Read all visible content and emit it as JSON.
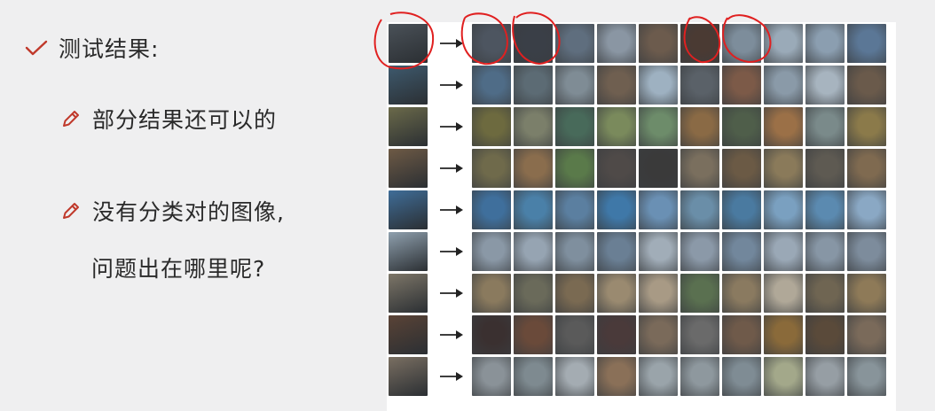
{
  "slide": {
    "heading": "测试结果:",
    "point1": "部分结果还可以的",
    "point2_line1": "没有分类对的图像,",
    "point2_line2": "问题出在哪里呢?"
  },
  "icons": {
    "heading_icon": "check-icon",
    "point_icon": "pencil-icon",
    "accent": "#c0392b"
  },
  "grid": {
    "rows": 9,
    "results_per_row": 10,
    "query_colors": [
      "#4a5158",
      "#3e5a6e",
      "#6b6a4a",
      "#6e5a45",
      "#3f6d98",
      "#8fa0ae",
      "#7d7668",
      "#5a4336",
      "#7a6f62"
    ],
    "row_palettes": [
      [
        "#4d5560",
        "#3a3f47",
        "#5f6e7e",
        "#8a96a3",
        "#6c5b4d",
        "#4a3a33",
        "#7d8d9b",
        "#9aaab8",
        "#8b9eb0",
        "#5b7796"
      ],
      [
        "#4f6c87",
        "#5c6b74",
        "#7f8c95",
        "#6f5f50",
        "#9eb1c1",
        "#5a6168",
        "#7c5a48",
        "#8a9aa8",
        "#a7b4bf",
        "#6a5a4b"
      ],
      [
        "#6d6a3f",
        "#7b7f6a",
        "#486a5a",
        "#7a8a5c",
        "#6d8c6a",
        "#8a6a45",
        "#4f5e4a",
        "#9b7047",
        "#7a8a8a",
        "#8b7a4a"
      ],
      [
        "#6f6a4b",
        "#8a6d4d",
        "#5a7a4a",
        "#4f4a48",
        "#3a3a3a",
        "#7a6f5e",
        "#6b5a45",
        "#8a7a5a",
        "#5e5a52",
        "#7f6a50"
      ],
      [
        "#3f6f9c",
        "#4a80a8",
        "#5b7fa0",
        "#3f78a8",
        "#6a90b4",
        "#6a8ea8",
        "#4a7aa0",
        "#7aa0c0",
        "#5b8ab0",
        "#8aa8c4"
      ],
      [
        "#8a98a6",
        "#96a4b2",
        "#7f8f9e",
        "#6a7f94",
        "#a1adb8",
        "#8b99a8",
        "#72879c",
        "#9aa8b6",
        "#8796a5",
        "#7d8c9c"
      ],
      [
        "#8a7a5e",
        "#6a6a5a",
        "#7a6a52",
        "#9a8a70",
        "#a89a85",
        "#5a7050",
        "#8a7a60",
        "#b0a898",
        "#6f6552",
        "#8e7a58"
      ],
      [
        "#3a3030",
        "#6a4a3a",
        "#5a5a5a",
        "#4a3a3a",
        "#7a6a5a",
        "#6a6a6a",
        "#6f5a4a",
        "#8a6a3a",
        "#5a4a3a",
        "#7a6a5a"
      ],
      [
        "#8a9298",
        "#7e8a90",
        "#a4acb2",
        "#8a7058",
        "#9aa4aa",
        "#8e989e",
        "#7f8c94",
        "#a3a88a",
        "#969ea4",
        "#88949a"
      ]
    ]
  }
}
